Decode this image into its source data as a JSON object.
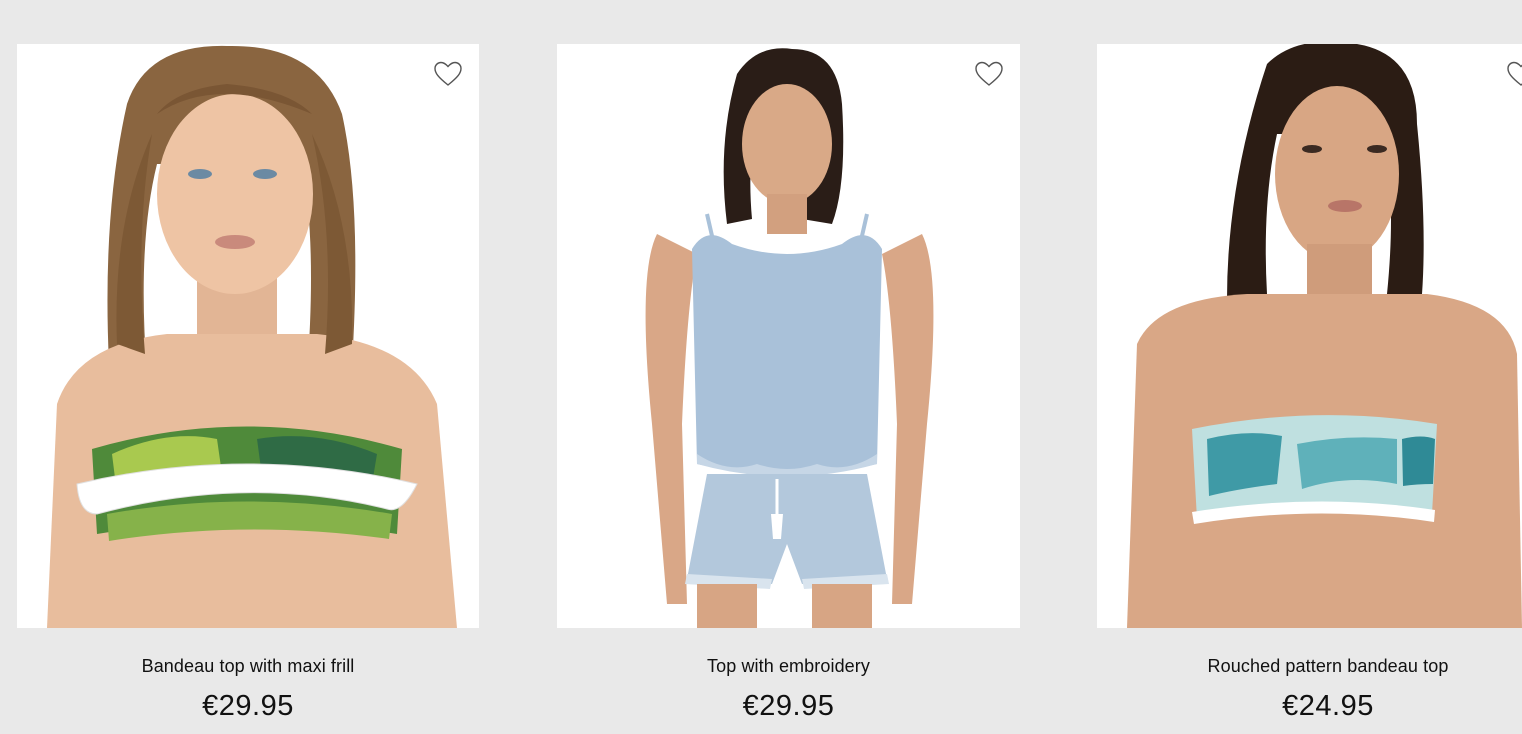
{
  "products": [
    {
      "name": "Bandeau top with maxi frill",
      "price": "€29.95",
      "wishlist_icon": "heart-outline-icon"
    },
    {
      "name": "Top with embroidery",
      "price": "€29.95",
      "wishlist_icon": "heart-outline-icon"
    },
    {
      "name": "Rouched pattern bandeau top",
      "price": "€24.95",
      "wishlist_icon": "heart-outline-icon"
    }
  ],
  "colors": {
    "page_background": "#e9e9e9",
    "card_background": "#ffffff",
    "text": "#111111"
  }
}
